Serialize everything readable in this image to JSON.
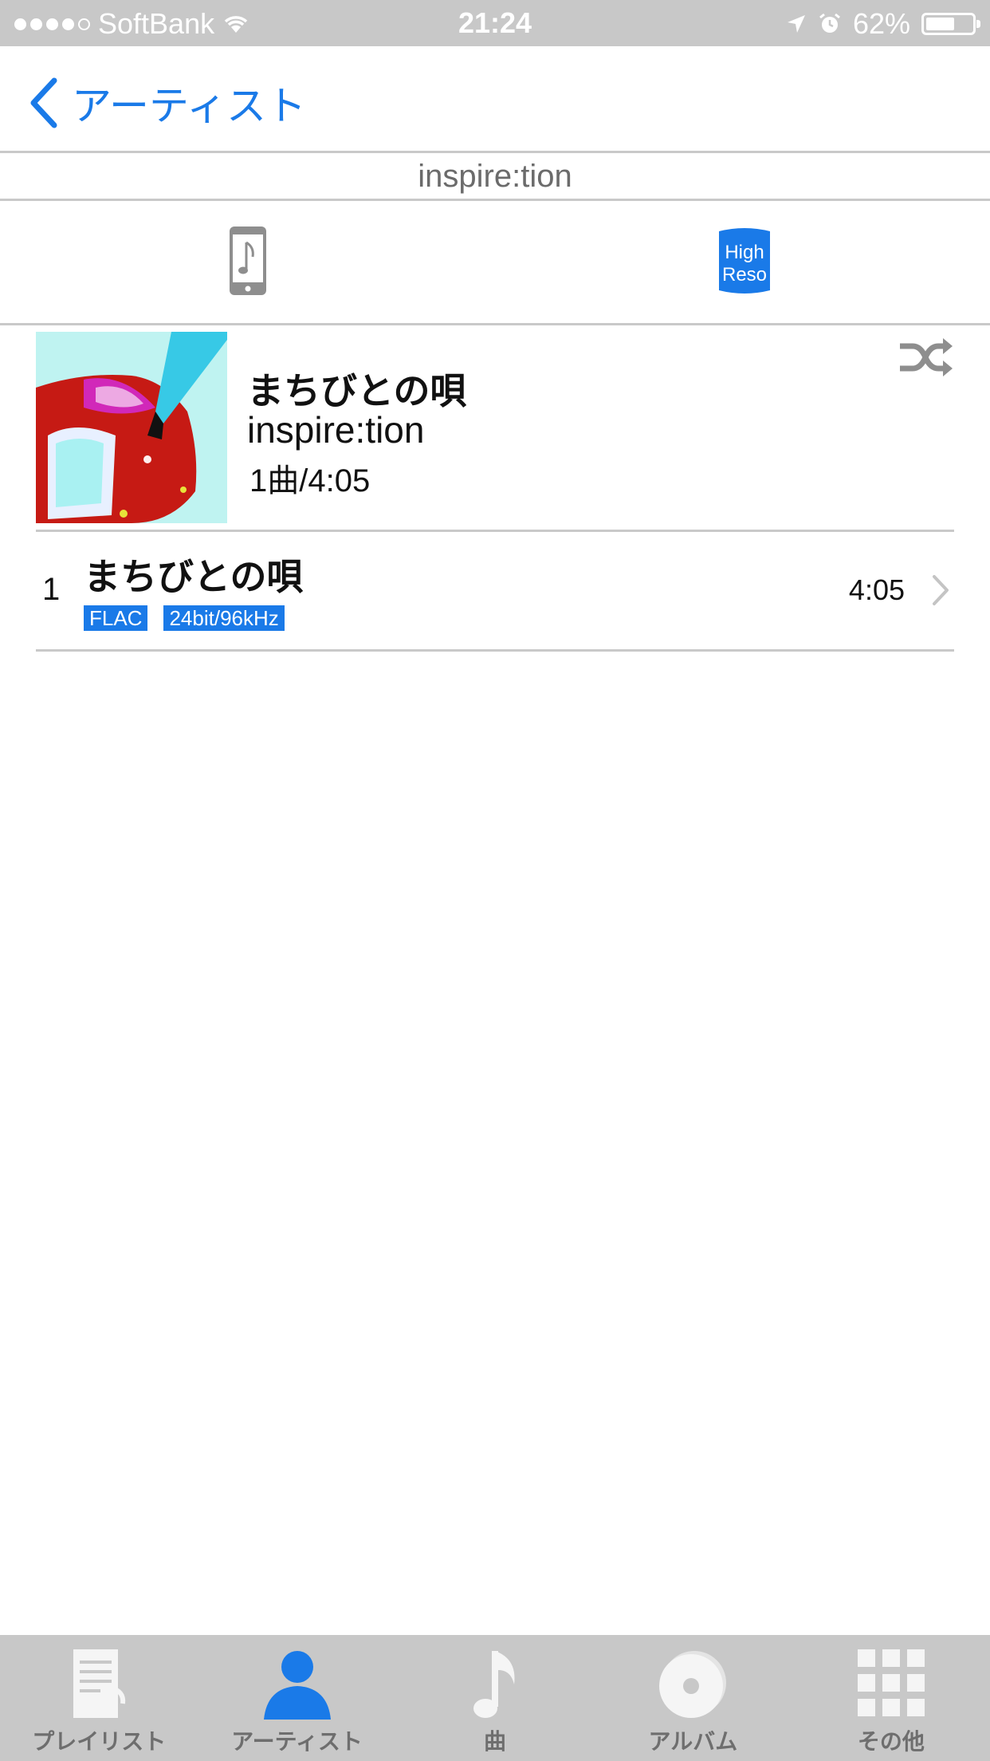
{
  "status_bar": {
    "carrier": "SoftBank",
    "time": "21:24",
    "battery_percent": "62%",
    "battery_level": 0.62,
    "signal_bars": 4,
    "signal_bars_total": 5
  },
  "nav": {
    "back_label": "アーティスト"
  },
  "artist_name": "inspire:tion",
  "filters": [
    {
      "name": "device-music-icon",
      "active": false
    },
    {
      "name": "high-reso-icon",
      "label_line1": "High",
      "label_line2": "Reso",
      "active": true
    }
  ],
  "album": {
    "title": "まちびとの唄",
    "artist": "inspire:tion",
    "info": "1曲/4:05"
  },
  "tracks": [
    {
      "number": "1",
      "title": "まちびとの唄",
      "tags": [
        "FLAC",
        "24bit/96kHz"
      ],
      "duration": "4:05"
    }
  ],
  "tabs": [
    {
      "label": "プレイリスト",
      "icon": "playlist-icon",
      "active": false
    },
    {
      "label": "アーティスト",
      "icon": "artist-icon",
      "active": true
    },
    {
      "label": "曲",
      "icon": "music-note-icon",
      "active": false
    },
    {
      "label": "アルバム",
      "icon": "album-disc-icon",
      "active": false
    },
    {
      "label": "その他",
      "icon": "grid-icon",
      "active": false
    }
  ],
  "colors": {
    "accent": "#1a7ae8",
    "status_bar_bg": "#c8c8c8",
    "tab_bar_bg": "#c8c8c8",
    "separator": "#c9c9c9"
  }
}
